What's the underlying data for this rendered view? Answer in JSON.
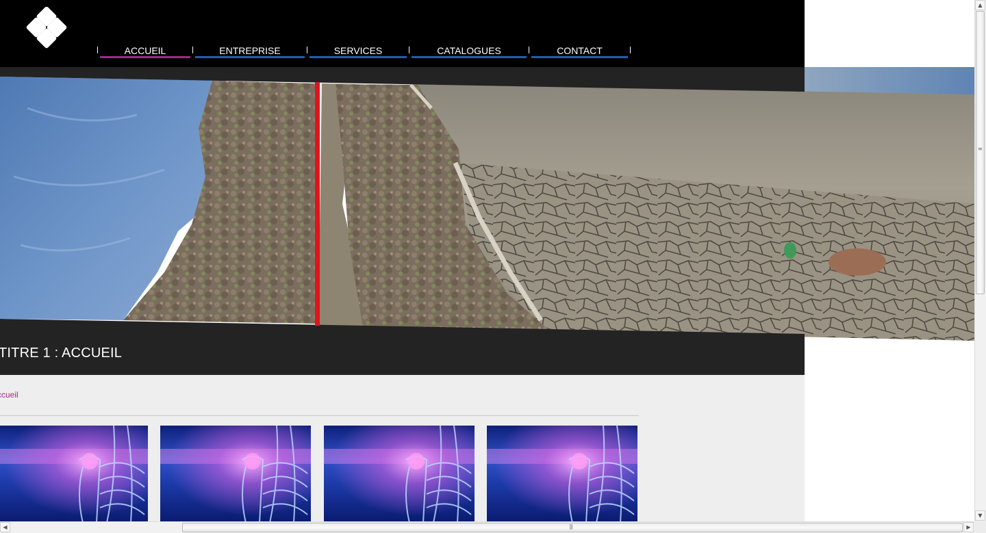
{
  "header": {
    "nav": [
      {
        "label": "ACCUEIL",
        "bar_color": "#a2278a"
      },
      {
        "label": "ENTREPRISE",
        "bar_color": "#1f5fb4"
      },
      {
        "label": "SERVICES",
        "bar_color": "#1f5fb4"
      },
      {
        "label": "CATALOGUES",
        "bar_color": "#1f5fb4"
      },
      {
        "label": "CONTACT",
        "bar_color": "#1f5fb4"
      }
    ]
  },
  "page": {
    "title": "TITRE 1 : ACCUEIL",
    "breadcrumb": "ccueil"
  },
  "thumbnails": [
    {
      "icon": "shoulder-xray-image"
    },
    {
      "icon": "shoulder-xray-image"
    },
    {
      "icon": "shoulder-xray-image"
    },
    {
      "icon": "shoulder-xray-image"
    }
  ],
  "colors": {
    "header_bg": "#000000",
    "title_band_bg": "#232323",
    "content_bg": "#eeeeee",
    "accent_active": "#a2278a",
    "accent_nav": "#1f5fb4",
    "banner_divider": "#e0141c"
  }
}
